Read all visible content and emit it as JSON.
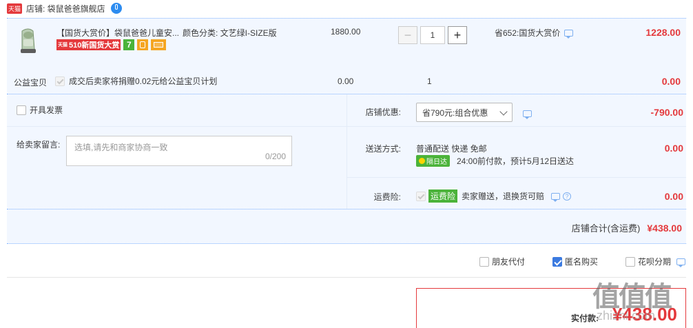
{
  "shop": {
    "tmall_badge": "天猫",
    "label": "店铺: 袋鼠爸爸旗舰店"
  },
  "item": {
    "title": "【国货大赏价】袋鼠爸爸儿童安...",
    "sku": "颜色分类: 文艺绿I-SIZE版",
    "promo_banner_prefix": "天猫",
    "promo_banner": "510新国货大赏",
    "tag_7": "7",
    "unit_price": "1880.00",
    "quantity": "1",
    "discount_note": "省652:国货大赏价",
    "subtotal": "1228.00"
  },
  "charity": {
    "label": "公益宝贝",
    "desc": "成交后卖家将捐赠0.02元给公益宝贝计划",
    "price": "0.00",
    "qty": "1",
    "total": "0.00"
  },
  "invoice": {
    "label": "开具发票"
  },
  "message": {
    "label": "给卖家留言:",
    "placeholder": "选填,请先和商家协商一致",
    "counter": "0/200"
  },
  "shop_discount": {
    "label": "店铺优惠:",
    "selected": "省790元:组合优惠",
    "amount": "-790.00"
  },
  "shipping": {
    "label": "送送方式:",
    "method": "普通配送 快递 免邮",
    "badge": "隔日达",
    "eta": "24:00前付款，预计5月12日送达",
    "amount": "0.00"
  },
  "insurance": {
    "label": "运费险:",
    "badge": "运费险",
    "desc": "卖家赠送，退换货可赔",
    "amount": "0.00"
  },
  "shop_total": {
    "label": "店铺合计(含运费)",
    "amount": "¥438.00"
  },
  "options": {
    "friend_pay": "朋友代付",
    "anonymous": "匿名购买",
    "huabei": "花呗分期"
  },
  "pay": {
    "label": "实付款:",
    "amount": "¥438.00"
  },
  "watermark": {
    "text": "值值值",
    "url": "zhizhi.com"
  }
}
